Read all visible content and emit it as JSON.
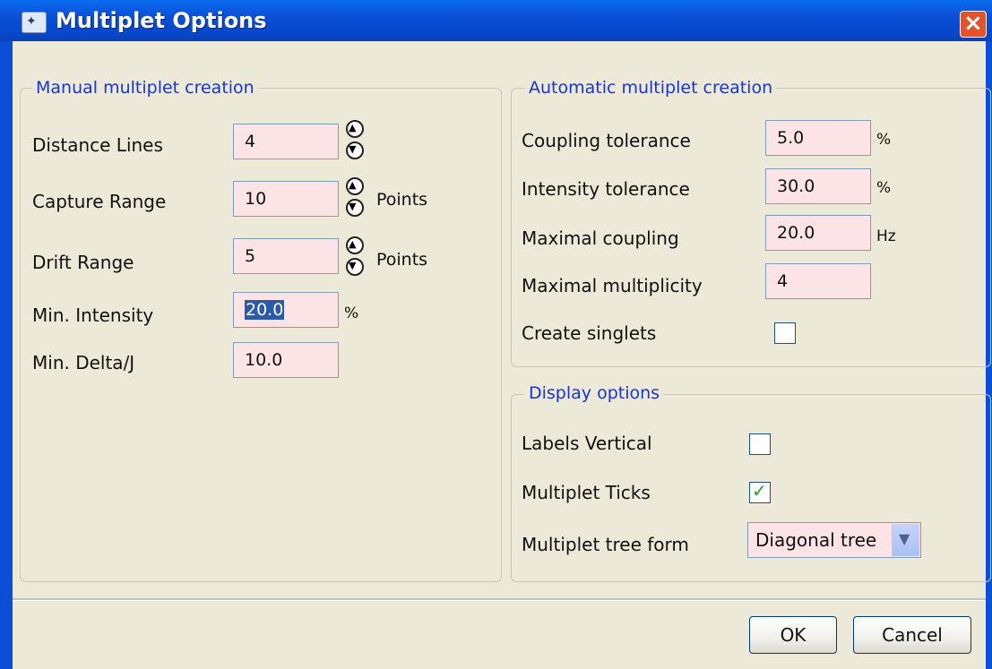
{
  "window": {
    "title": "Multiplet Options"
  },
  "manual": {
    "legend": "Manual multiplet creation",
    "distance_lines": {
      "label": "Distance Lines",
      "value": "4"
    },
    "capture_range": {
      "label": "Capture Range",
      "value": "10",
      "unit": "Points"
    },
    "drift_range": {
      "label": "Drift Range",
      "value": "5",
      "unit": "Points"
    },
    "min_intensity": {
      "label": "Min. Intensity",
      "value": "20.0",
      "unit": "%"
    },
    "min_delta_j": {
      "label": "Min. Delta/J",
      "value": "10.0"
    }
  },
  "automatic": {
    "legend": "Automatic multiplet creation",
    "coupling_tolerance": {
      "label": "Coupling tolerance",
      "value": "5.0",
      "unit": "%"
    },
    "intensity_tolerance": {
      "label": "Intensity tolerance",
      "value": "30.0",
      "unit": "%"
    },
    "maximal_coupling": {
      "label": "Maximal coupling",
      "value": "20.0",
      "unit": "Hz"
    },
    "maximal_multiplicity": {
      "label": "Maximal multiplicity",
      "value": "4"
    },
    "create_singlets": {
      "label": "Create singlets",
      "checked": false
    }
  },
  "display": {
    "legend": "Display options",
    "labels_vertical": {
      "label": "Labels Vertical",
      "checked": false
    },
    "multiplet_ticks": {
      "label": "Multiplet Ticks",
      "checked": true
    },
    "tree_form": {
      "label": "Multiplet tree form",
      "value": "Diagonal tree"
    }
  },
  "buttons": {
    "ok": "OK",
    "cancel": "Cancel"
  },
  "icons": {
    "app": "app-icon",
    "close": "close-icon",
    "spin_up": "spin-up-icon",
    "spin_down": "spin-down-icon",
    "check": "checkmark-icon",
    "dropdown": "chevron-down-icon"
  },
  "colors": {
    "titlebar": "#0a4fd6",
    "field_bg": "#fbe3e6",
    "legend_text": "#1a34d4",
    "close_button": "#e2532d"
  }
}
